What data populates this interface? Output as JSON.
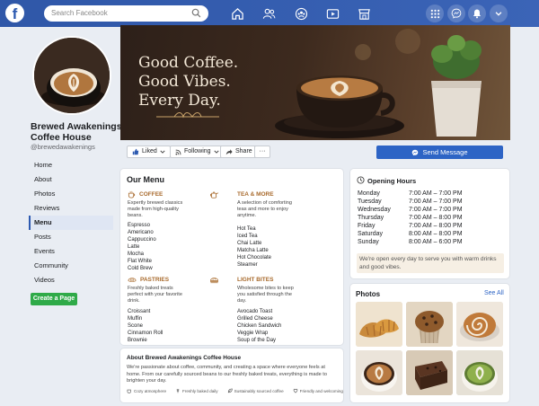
{
  "topbar": {
    "logo": "f",
    "search_placeholder": "Search Facebook",
    "nav_icons": [
      "home-icon",
      "friends-icon",
      "groups-icon",
      "watch-icon",
      "marketplace-icon"
    ],
    "right_icons": [
      "menu-grid-icon",
      "messenger-icon",
      "notifications-bell-icon",
      "account-chevron-icon"
    ],
    "accent": "#2f57a8"
  },
  "profile": {
    "name": "Brewed Awakenings Coffee House",
    "handle": "@brewedawakenings"
  },
  "sidebar": {
    "items": [
      {
        "label": "Home",
        "active": false
      },
      {
        "label": "About",
        "active": false
      },
      {
        "label": "Photos",
        "active": false
      },
      {
        "label": "Reviews",
        "active": false
      },
      {
        "label": "Menu",
        "active": true
      },
      {
        "label": "Posts",
        "active": false
      },
      {
        "label": "Events",
        "active": false
      },
      {
        "label": "Community",
        "active": false
      },
      {
        "label": "Videos",
        "active": false
      }
    ],
    "create_page": "Create a Page"
  },
  "cover": {
    "lines": [
      "Good Coffee.",
      "Good Vibes.",
      "Every Day."
    ]
  },
  "actions": {
    "liked": "Liked",
    "following": "Following",
    "share": "Share",
    "more": "···",
    "send_message": "Send Message"
  },
  "menu": {
    "title": "Our Menu",
    "sections": [
      {
        "name": "COFFEE",
        "icon": "coffee-cup-icon",
        "desc": "Expertly brewed classics made from high-quality beans.",
        "items": [
          "Espresso",
          "Americano",
          "Cappuccino",
          "Latte",
          "Mocha",
          "Flat White",
          "Cold Brew"
        ]
      },
      {
        "name": "TEA & MORE",
        "icon": "teapot-icon",
        "desc": "A selection of comforting teas and more to enjoy anytime.",
        "items": [
          "Hot Tea",
          "Iced Tea",
          "Chai Latte",
          "Matcha Latte",
          "Hot Chocolate",
          "Steamer"
        ]
      },
      {
        "name": "PASTRIES",
        "icon": "croissant-icon",
        "desc": "Freshly baked treats perfect with your favorite drink.",
        "items": [
          "Croissant",
          "Muffin",
          "Scone",
          "Cinnamon Roll",
          "Brownie"
        ]
      },
      {
        "name": "LIGHT BITES",
        "icon": "sandwich-icon",
        "desc": "Wholesome bites to keep you satisfied through the day.",
        "items": [
          "Avocado Toast",
          "Grilled Cheese",
          "Chicken Sandwich",
          "Veggie Wrap",
          "Soup of the Day"
        ]
      }
    ]
  },
  "about": {
    "title": "About Brewed Awakenings Coffee House",
    "text": "We're passionate about coffee, community, and creating a space where everyone feels at home. From our carefully sourced beans to our freshly baked treats, everything is made to brighten your day.",
    "tags": [
      "Cozy atmosphere",
      "Freshly baked daily",
      "Sustainably sourced coffee",
      "Friendly and welcoming"
    ]
  },
  "hours": {
    "title": "Opening Hours",
    "rows": [
      {
        "day": "Monday",
        "time": "7:00 AM – 7:00 PM"
      },
      {
        "day": "Tuesday",
        "time": "7:00 AM – 7:00 PM"
      },
      {
        "day": "Wednesday",
        "time": "7:00 AM – 7:00 PM"
      },
      {
        "day": "Thursday",
        "time": "7:00 AM – 8:00 PM"
      },
      {
        "day": "Friday",
        "time": "7:00 AM – 8:00 PM"
      },
      {
        "day": "Saturday",
        "time": "8:00 AM – 8:00 PM"
      },
      {
        "day": "Sunday",
        "time": "8:00 AM – 6:00 PM"
      }
    ],
    "note": "We're open every day to serve you with warm drinks and good vibes."
  },
  "photos": {
    "title": "Photos",
    "see_all": "See All",
    "items": [
      "croissants-photo",
      "muffin-photo",
      "cinnamon-roll-photo",
      "latte-art-photo",
      "brownie-photo",
      "matcha-latte-photo"
    ]
  }
}
